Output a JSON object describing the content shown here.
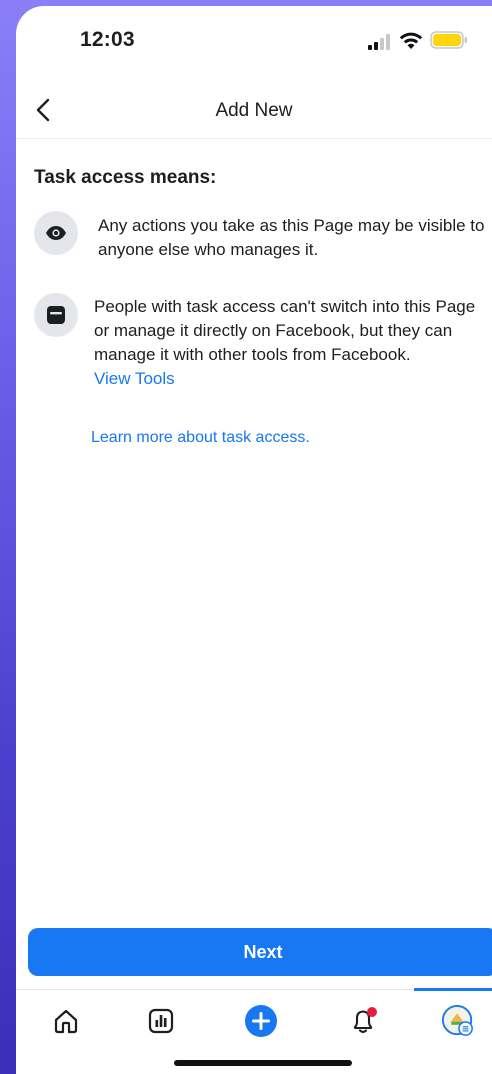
{
  "status_bar": {
    "time": "12:03",
    "icons": [
      "cellular-signal-icon",
      "wifi-icon",
      "battery-low-icon"
    ],
    "battery_color": "#ffd60a"
  },
  "header": {
    "title": "Add New",
    "back_icon": "chevron-left-icon"
  },
  "content": {
    "heading": "Task access means:",
    "items": [
      {
        "icon": "eye-icon",
        "text": "Any actions you take as this Page may be visible to anyone else who manages it."
      },
      {
        "icon": "tools-icon",
        "text": "People with task access can't switch into this Page or manage it directly on Facebook, but they can manage it with other tools from Facebook.",
        "link": "View Tools"
      }
    ],
    "learn_more": "Learn more about task access."
  },
  "actions": {
    "next_label": "Next"
  },
  "tab_bar": {
    "tabs": [
      {
        "name": "home",
        "icon": "home-icon",
        "active": false
      },
      {
        "name": "insights",
        "icon": "bar-chart-icon",
        "active": false
      },
      {
        "name": "create",
        "icon": "plus-circle-icon",
        "active": false
      },
      {
        "name": "notifications",
        "icon": "bell-icon",
        "active": false,
        "has_badge": true
      },
      {
        "name": "profile",
        "icon": "page-avatar-icon",
        "active": true
      }
    ]
  },
  "colors": {
    "accent": "#1877f2",
    "badge": "#e41e3f",
    "background_gradient": [
      "#8a7ff7",
      "#3b2fb8"
    ]
  }
}
